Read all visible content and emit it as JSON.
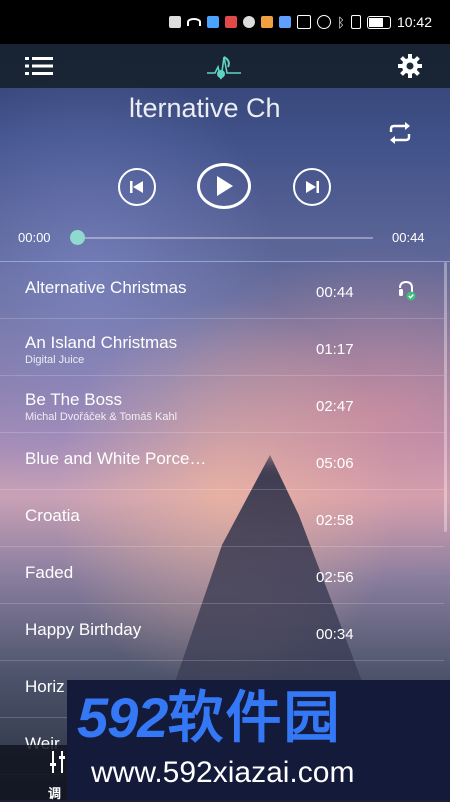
{
  "status_bar": {
    "time": "10:42"
  },
  "now_playing": {
    "title": "Alternative Christmas",
    "title_visible": "lternative Ch",
    "current_time": "00:00",
    "duration": "00:44",
    "progress": 0.0
  },
  "tracks": [
    {
      "title": "Alternative Christmas",
      "artist": "",
      "duration": "00:44",
      "playing": true
    },
    {
      "title": "An Island Christmas",
      "artist": "Digital Juice",
      "duration": "01:17"
    },
    {
      "title": "Be The Boss",
      "artist": "Michal Dvořáček & Tomáš Kahl",
      "duration": "02:47"
    },
    {
      "title": "Blue and White Porce…",
      "artist": "",
      "duration": "05:06"
    },
    {
      "title": "Croatia",
      "artist": "",
      "duration": "02:58"
    },
    {
      "title": "Faded",
      "artist": "",
      "duration": "02:56"
    },
    {
      "title": "Happy Birthday",
      "artist": "",
      "duration": "00:34"
    },
    {
      "title": "Horiz",
      "artist": "",
      "duration": ""
    },
    {
      "title": "Weir",
      "artist": "",
      "duration": ""
    }
  ],
  "bottom_tab": {
    "label": "调"
  },
  "watermark": {
    "brand_digits": "592",
    "brand_cn": "软件园",
    "url": "www.592xiazai.com"
  },
  "colors": {
    "accent": "#7fd3c8",
    "watermark_blue": "#3478f6",
    "watermark_bg": "#131a3a"
  },
  "icons": [
    "menu-icon",
    "music-note-icon",
    "gear-icon",
    "repeat-icon",
    "previous-icon",
    "play-icon",
    "next-icon",
    "now-playing-icon",
    "equalizer-icon"
  ]
}
